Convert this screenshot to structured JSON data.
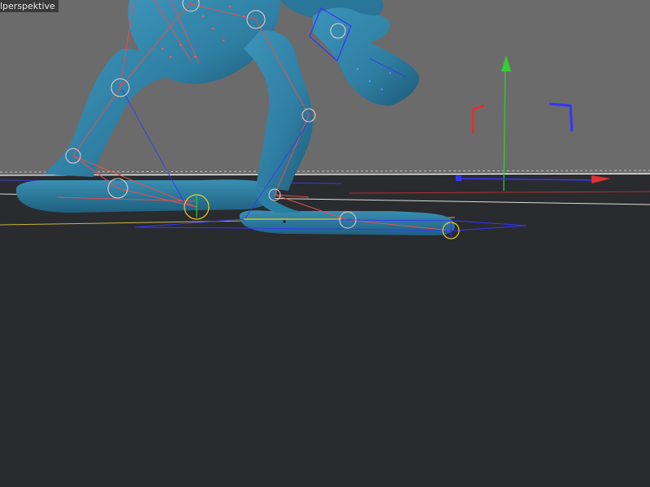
{
  "viewport": {
    "label": "lperspektive",
    "colors": {
      "background_upper": "#6b6b6b",
      "floor": "#2a2b2e",
      "mesh": "#2f7fa3",
      "mesh_dark": "#1f5f7e",
      "bone": "#e05050",
      "joint_circle": "#f0d0c0",
      "controller": "#e8d020",
      "ik_blue": "#3030ff",
      "axis_x": "#e03030",
      "axis_y": "#30d030",
      "axis_z": "#3030e0",
      "horizon": "#ffffff"
    },
    "icons": [
      "axis-gizmo-icon",
      "y-axis-arrow-icon",
      "x-axis-handle-icon",
      "z-axis-handle-icon"
    ]
  }
}
